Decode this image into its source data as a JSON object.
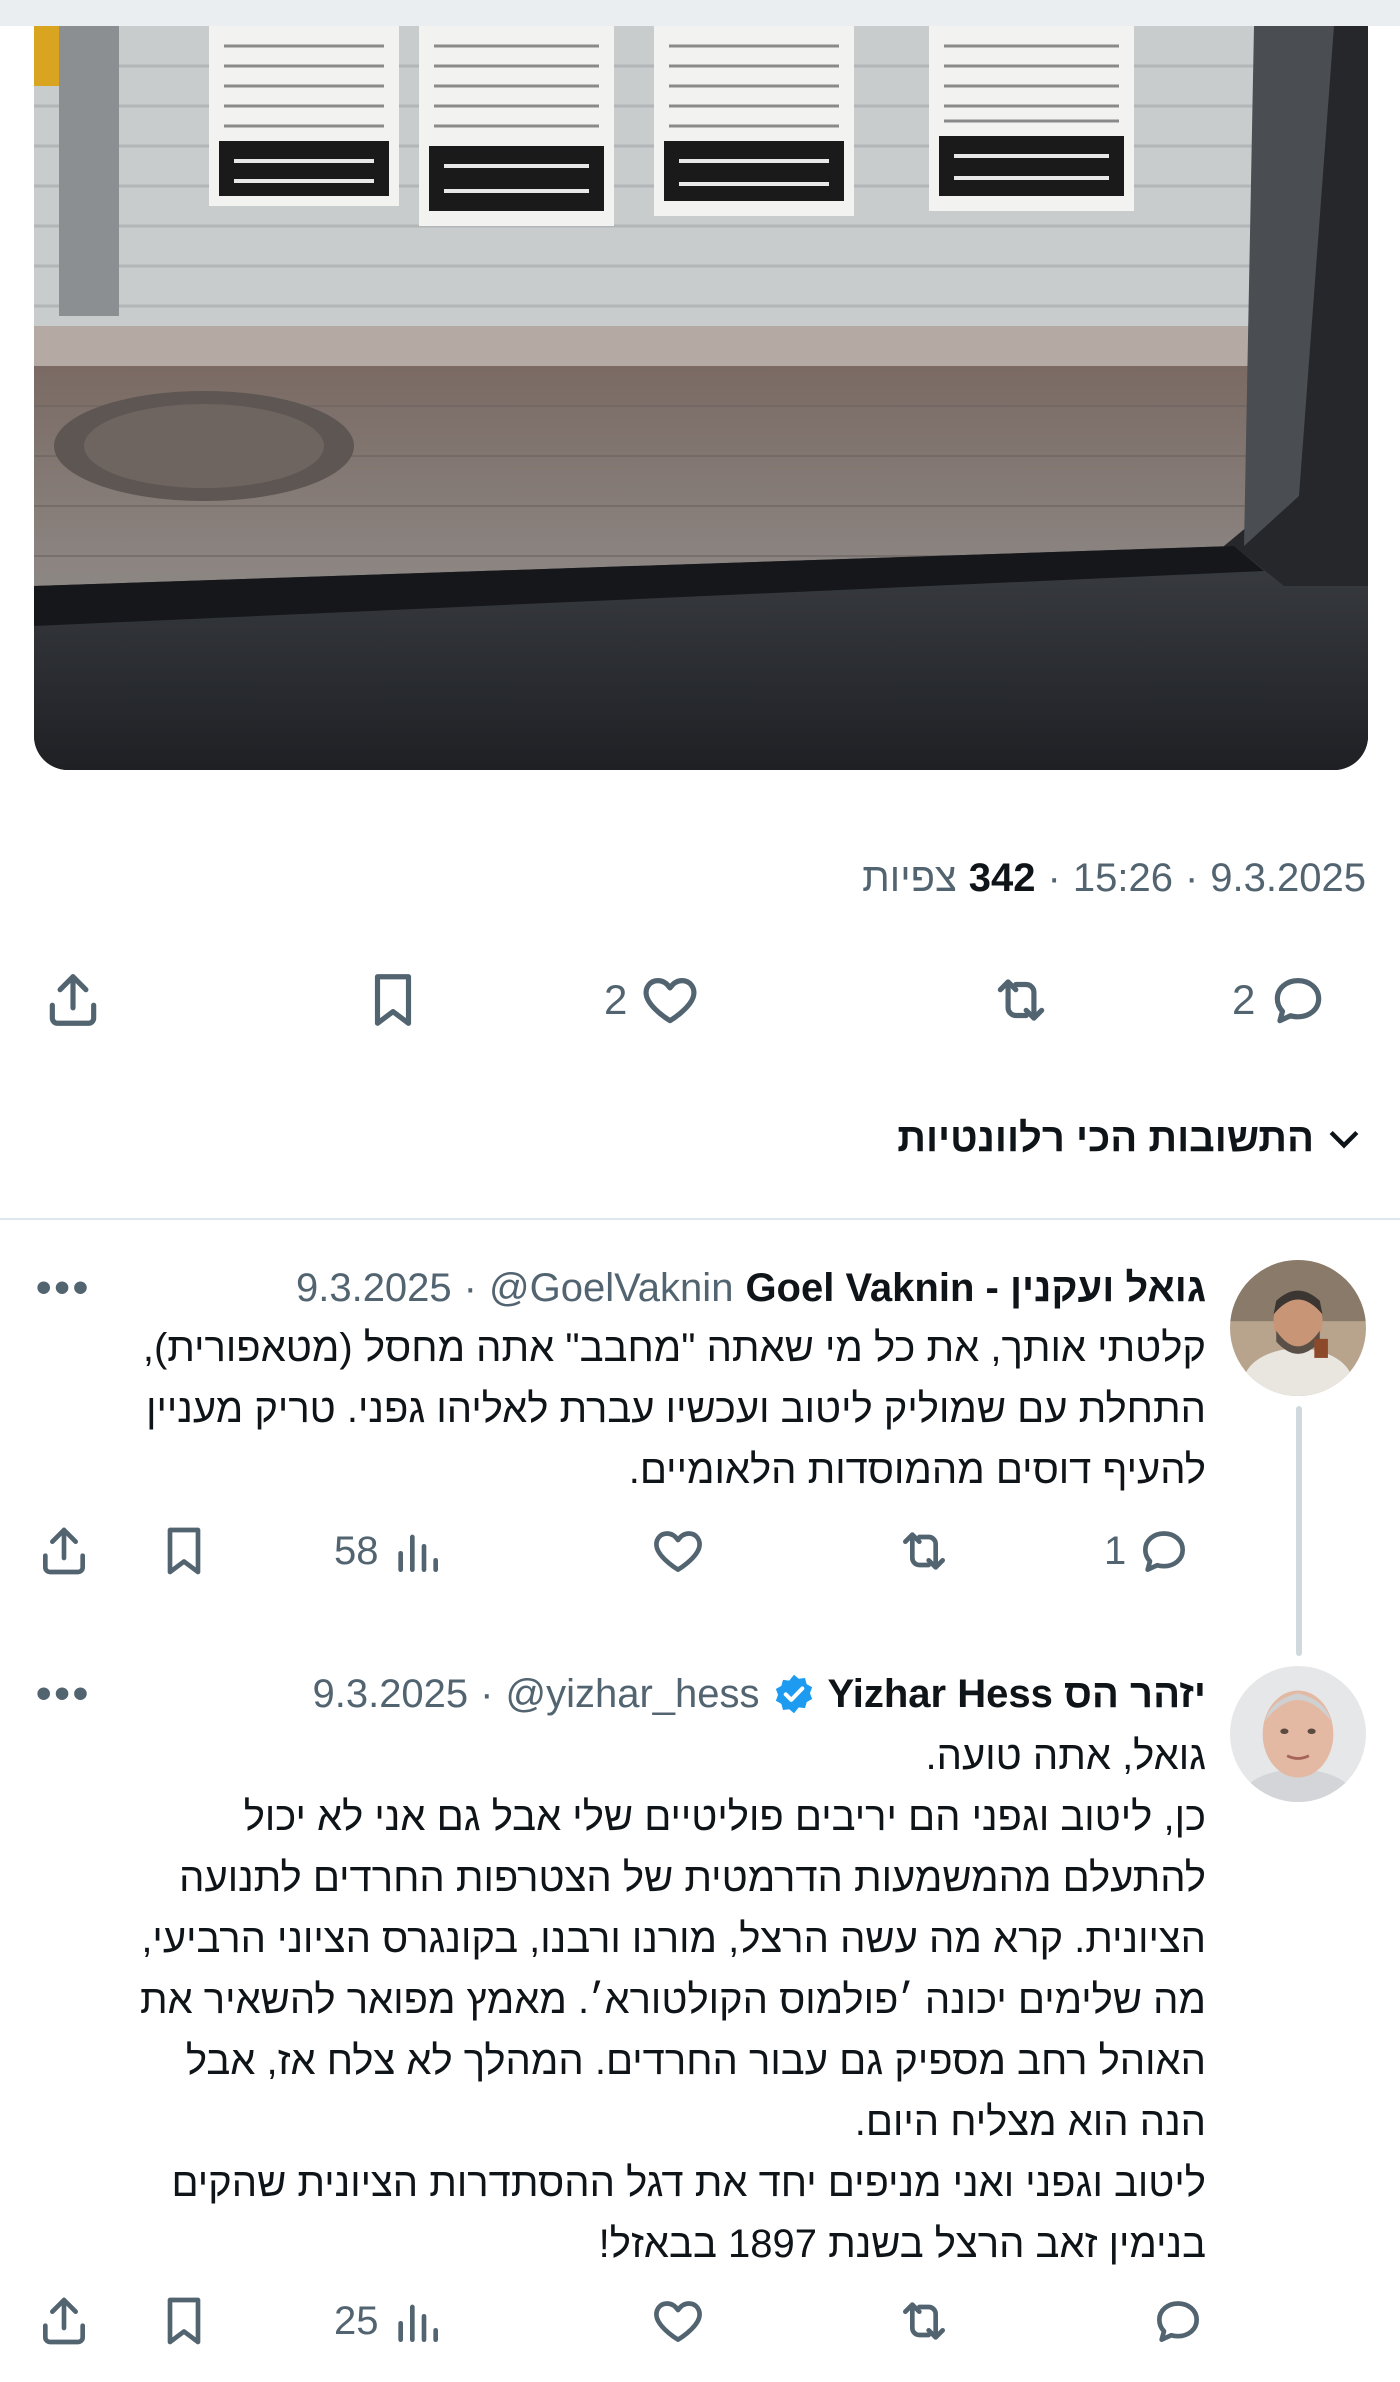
{
  "tweet": {
    "date": "9.3.2025",
    "time": "15:26",
    "views_count": "342",
    "views_label": "צפיות",
    "reply_count": "2",
    "retweet_count": "",
    "like_count": "2",
    "icons": [
      "reply-icon",
      "retweet-icon",
      "like-icon",
      "bookmark-icon",
      "share-icon"
    ]
  },
  "replies_header": {
    "label": "התשובות הכי רלוונטיות",
    "icon": "chevron-down-icon"
  },
  "replies": [
    {
      "display_name": "גואל ועקנין - Goel Vaknin",
      "handle": "@GoelVaknin",
      "date": "9.3.2025",
      "text_lines": [
        "קלטתי אותך, את כל מי שאתה \"מחבב\" אתה מחסל (מטאפורית),",
        "התחלת עם שמוליק ליטוב ועכשיו עברת לאליהו גפני. טריק מעניין",
        "להעיף דוסים מהמוסדות הלאומיים."
      ],
      "reply_count": "1",
      "views_count": "58"
    },
    {
      "display_name": "יזהר הס Yizhar Hess",
      "handle": "@yizhar_hess",
      "date": "9.3.2025",
      "verified": true,
      "text_lines": [
        "גואל, אתה טועה.",
        "כן, ליטוב וגפני הם יריבים פוליטיים שלי אבל גם אני לא יכול",
        "להתעלם מהמשמעות הדרמטית של הצטרפות החרדים לתנועה",
        "הציונית. קרא מה עשה הרצל, מורנו ורבנו, בקונגרס הציוני הרביעי,",
        "מה שלימים יכונה ׳פולמוס הקולטורא׳. מאמץ מפואר להשאיר את",
        "האוהל רחב מספיק גם עבור החרדים. המהלך לא צלח אז, אבל",
        "הנה הוא מצליח היום.",
        "ליטוב וגפני ואני מניפים יחד את דגל ההסתדרות הציונית שהקים",
        "בנימין זאב הרצל בשנת 1897 בבאזל!"
      ],
      "reply_count": "",
      "views_count": "25"
    }
  ],
  "colors": {
    "text": "#0f1419",
    "secondary": "#536471",
    "divider": "#e1e8ed",
    "verified_blue": "#1d9bf0"
  }
}
